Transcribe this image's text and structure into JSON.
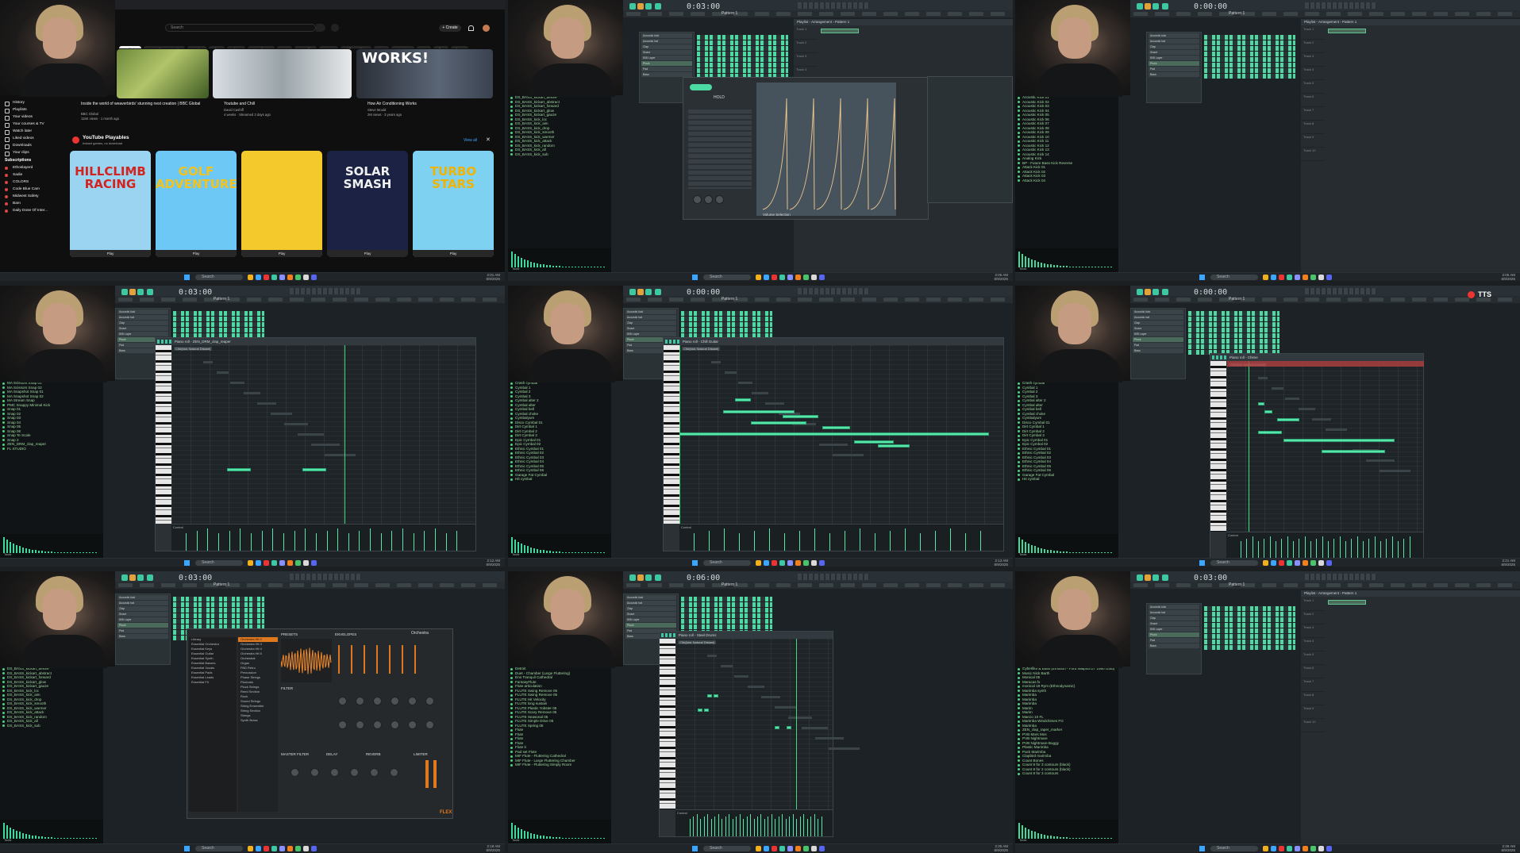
{
  "youtube": {
    "search_placeholder": "Search",
    "create_label": "+ Create",
    "chips": [
      "Prediction",
      "Nature documentaries",
      "Gaming",
      "Mixes",
      "Animes",
      "Invertebrates",
      "Guns",
      "Comedies",
      "Oceans",
      "Gridlyun videos",
      "News",
      "Astronomy",
      "NBA",
      "Bikes",
      "History"
    ],
    "nav": [
      "History",
      "Playlists",
      "Your videos",
      "Your courses & TV",
      "Watch later",
      "Liked videos",
      "Downloads",
      "Your clips"
    ],
    "subs_header": "Subscriptions",
    "subs": [
      "Ethoslayerd",
      "Sadie",
      "COLORS",
      "Code Blue Cam",
      "Midwest Safety",
      "Bam",
      "Daily Dose Of Inter..."
    ],
    "videos": [
      {
        "title": "Inside the world of weaverbirds' stunning nest creation | BBC Global",
        "meta1": "BBC Global",
        "meta2": "115K views · 1 month ago"
      },
      {
        "title": "Youtube and Chill",
        "meta1": "David Cashiff",
        "meta2": "4 weeks · Streamed 3 days ago"
      },
      {
        "title": "How Air Conditioning Works",
        "meta1": "Steve Mould",
        "meta2": "2M views · 3 years ago"
      }
    ],
    "thumb_text": "WORKS!",
    "playables_title": "YouTube Playables",
    "playables_sub": "Instant games, no download",
    "view_all": "View all",
    "games": [
      {
        "title": "HILLCLIMB RACING",
        "label": "Play",
        "bg": "#9bd4f0",
        "fg": "#d3231f"
      },
      {
        "title": "GOLF ADVENTURES",
        "label": "Play",
        "bg": "#6ec8f5",
        "fg": "#f3c21b"
      },
      {
        "title": "",
        "label": "Play",
        "bg": "#f4c92b",
        "fg": "#e33"
      },
      {
        "title": "SOLAR SMASH",
        "label": "Play",
        "bg": "#1b2244",
        "fg": "#f0f0f0"
      },
      {
        "title": "TURBO STARS",
        "label": "Play",
        "bg": "#7fd1f1",
        "fg": "#f2b300"
      }
    ]
  },
  "fl": {
    "times": [
      "0:03:00",
      "0:00:00",
      "0:03:00",
      "0:00:00",
      "0:00:00",
      "0:03:00",
      "0:06:00",
      "0:03:00"
    ],
    "pattern": "Pattern 1",
    "playlist_title": "Playlist - Arrangement › Pattern 1",
    "tracks": [
      "Track 1",
      "Track 2",
      "Track 3",
      "Track 4",
      "Track 5",
      "Track 6",
      "Track 7",
      "Track 8",
      "Track 9",
      "Track 10"
    ],
    "channels": [
      "Acoustic kick",
      "Acoustic hat",
      "Clap",
      "Snare",
      "808 Layer",
      "Pluck",
      "Pad",
      "Bass"
    ],
    "browser_kits": [
      "DS_BASS_kickart_before",
      "DS_BASS_kickart_abstract",
      "DS_BASS_kickart_forward",
      "DS_BASS_kickart_glow",
      "DS_BASS_kickart_gauze",
      "DS_BASS_kick_loc",
      "DS_BASS_kick_aim",
      "DS_BASS_kick_drop",
      "DS_BASS_kick_smooth",
      "DS_BASS_kick_warmer",
      "DS_BASS_kick_attack",
      "DS_BASS_kick_random",
      "DS_BASS_kick_all",
      "DS_BASS_kick_sub"
    ],
    "browser_cymbals": [
      "Crash cymbal",
      "Cymbal 1",
      "Cymbal 2",
      "Cymbal 3",
      "Cymbal alter 2",
      "Cymbal alter",
      "Cymbal bell",
      "Cymbal choke",
      "Cymbalyum",
      "Disco Cymbal 01",
      "Dirt Cymbal 1",
      "Dirt Cymbal 2",
      "Dirt Cymbal 3",
      "Epic Cymbal 01",
      "Epic Cymbal 02",
      "Ethnic Cymbal 01",
      "Ethnic Cymbal 02",
      "Ethnic Cymbal 03",
      "Ethnic Cymbal 04",
      "Ethnic Cymbal 05",
      "Ethnic Cymbal 06",
      "Garage Fat Cymbal",
      "Hit cymbal"
    ],
    "browser_kicks": [
      "Acoustic Kick 01",
      "Acoustic Kick 02",
      "Acoustic Kick 03",
      "Acoustic Kick 04",
      "Acoustic Kick 05",
      "Acoustic Kick 06",
      "Acoustic Kick 07",
      "Acoustic Kick 08",
      "Acoustic Kick 09",
      "Acoustic Kick 10",
      "Acoustic Kick 11",
      "Acoustic Kick 12",
      "Acoustic Kick 13",
      "Acoustic Kick 14",
      "Analog Kick",
      "BP - Future Bass Kick Reverse",
      "Attack Kick 01",
      "Attack Kick 02",
      "Attack Kick 03",
      "Attack Kick 04"
    ],
    "browser_snaps": [
      "MA Scissors Snap 01",
      "MA Scissors Snap 02",
      "MA Snapshot Snap 01",
      "MA Snapshot Snap 02",
      "MA Stream Snap",
      "PMC Snappy Minimal Kick",
      "Snap 01",
      "Snap 02",
      "Snap 03",
      "Snap 04",
      "Snap 05",
      "Snap 06",
      "Snap Te Scale",
      "Snap 2",
      "ZEN_DRM_clap_reaper",
      "FL STUDIO"
    ],
    "browser_flute": [
      "Detroit",
      "Duet - Chamber (Large Fluttering)",
      "Eno Tranquil Cathedral",
      "FantasyFlute",
      "Flute articulation",
      "FLUTE Swing Remove 05",
      "FLUTE Swing Remove 05",
      "FLUTE Hit Velocity",
      "FLUTE long sustain",
      "FLUTE Plastic Yobster 05",
      "FLUTE Scary Remove 05",
      "FLUTE Seasonal 05",
      "FLUTE Simple Drive 05",
      "FLUTE Spring 05",
      "Flute",
      "Flute",
      "Flute",
      "Flute",
      "Flute it",
      "Pad set Flute",
      "MIF Flute - Fluttering Cathedral",
      "MIF Flute - Large Fluttering Chamber",
      "MIF Flute - Fluttering Simply Room"
    ],
    "browser_misc": [
      "Cyberlike & Bass (Emotion - Ford Walpha DT 1990 Gold)",
      "Music Nick Barth",
      "Monical 05",
      "Maracas fx",
      "monical 18 Rym (Ethnodynamic)",
      "Marimba synth",
      "Marimba",
      "Marimba",
      "Marimba",
      "Marim",
      "Marim",
      "Marcio 10 FL",
      "Marimba Windchimes FG",
      "Marimba",
      "ZEN_clap_raper_marker",
      "PVB Mars Mos",
      "PVB Nightmare",
      "PVB Nightmare Buggy",
      "Plastic Marimba",
      "Pack Marimba",
      "Clapbird marimba",
      "Count Bones",
      "Count 8 for 3 contours (black)",
      "Count 8 for 2 contours (black)",
      "Count 8 for 3 contours"
    ],
    "preview_label": "Tools",
    "piano_titles": [
      "Piano roll - ZEN_DRM_clap_reaper",
      "Piano roll - Chill Guitar",
      "Piano roll - Chime",
      "Piano roll - Steel Drums"
    ],
    "control_label": "Control",
    "patch_name": "C5#(kick Natural Distant)",
    "plugin_patch": "Volume Selection",
    "plugin_hold": "HOLD",
    "flex_title": "Orchestra",
    "flex_brand": "FLEX",
    "flex_sections": [
      "PRESETS",
      "ENVELOPES",
      "FILTER",
      "MASTER FILTER",
      "DELAY",
      "REVERB",
      "LIMITER"
    ],
    "flex_presets": [
      "Orchestra Hit 2",
      "Orchestra Hit 3",
      "Orchestra Hit 4",
      "Orchestra Hit 5",
      "Orchestral",
      "Organ",
      "PAD Retro",
      "Percussion",
      "Phase Strings",
      "Pizzicato",
      "Pluck Strings",
      "Reed Section",
      "Rock",
      "Sound Strings",
      "String Ensemble",
      "String Section",
      "Strings",
      "Synth Brass"
    ],
    "flex_library": [
      "Library",
      "Essential Orchestra",
      "Essential Keys",
      "Essential Guitar",
      "Essential Synth",
      "Essential Basses",
      "Essential Vocals",
      "Essential Pads",
      "Essential Leads",
      "Essential FX"
    ]
  },
  "taskbar": {
    "search": "Search",
    "times": [
      "2:01 AM",
      "2:05 AM",
      "2:05 AM",
      "2:12 AM",
      "2:13 AM",
      "2:21 AM",
      "2:18 AM",
      "2:25 AM",
      "2:28 AM"
    ],
    "date": "8/9/2025"
  },
  "overlay": {
    "tts": "TTS"
  },
  "colors": {
    "accent": "#3ec8a1",
    "note": "#57e6a8",
    "bg": "#1c2226",
    "yt_bg": "#0f0f0f"
  }
}
